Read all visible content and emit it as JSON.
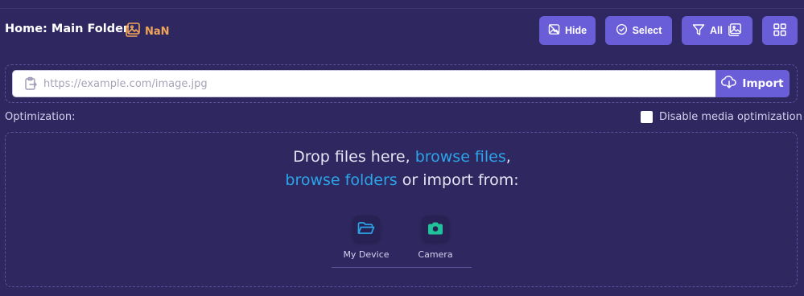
{
  "header": {
    "title": "Home: Main Folder",
    "count": "NaN",
    "buttons": {
      "hide": "Hide",
      "select": "Select",
      "filter": "All"
    }
  },
  "url_import": {
    "placeholder": "https://example.com/image.jpg",
    "value": "",
    "button": "Import"
  },
  "optimization": {
    "label": "Optimization:",
    "checkbox_label": "Disable media optimization",
    "checked": false
  },
  "drop_zone": {
    "line1_text": "Drop files here, ",
    "line1_link": "browse files",
    "line1_suffix": ",",
    "line2_link": "browse folders",
    "line2_text": " or import from:",
    "sources": [
      {
        "label": "My Device",
        "icon": "folder-open-icon"
      },
      {
        "label": "Camera",
        "icon": "camera-icon"
      }
    ]
  },
  "colors": {
    "background": "#2f2860",
    "accent": "#6a5ed8",
    "link": "#2ba4e8",
    "count": "#f0a45a",
    "camera": "#1fc29a"
  }
}
